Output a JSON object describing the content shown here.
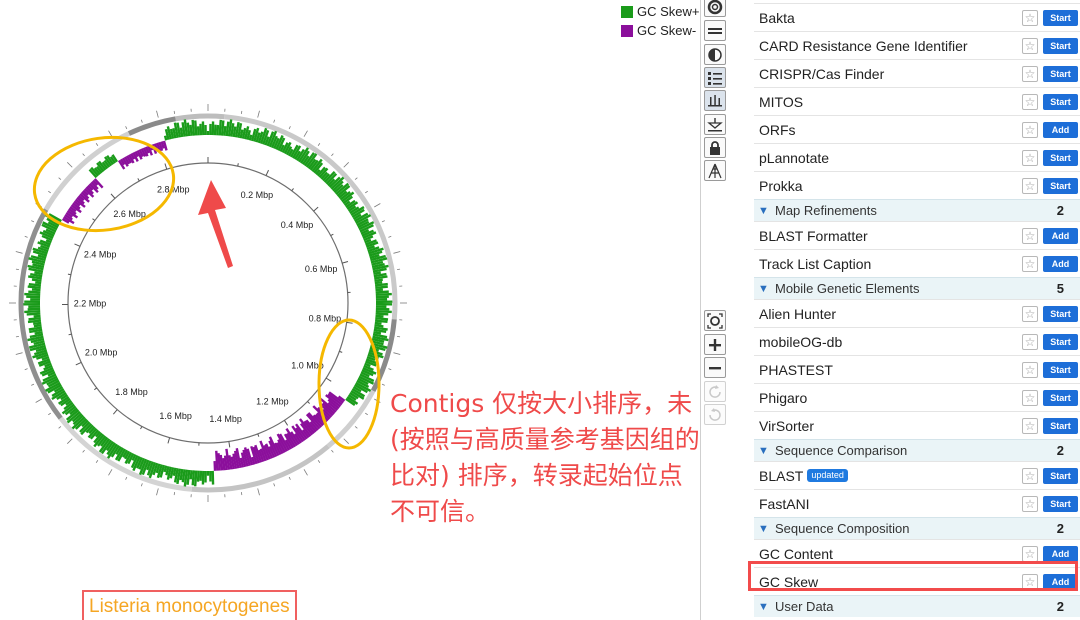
{
  "legend": [
    {
      "label": "GC Skew+",
      "color": "#1a9b1a"
    },
    {
      "label": "GC Skew-",
      "color": "#8b0f9b"
    }
  ],
  "map": {
    "tick_labels": [
      "0.2 Mbp",
      "0.4 Mbp",
      "0.6 Mbp",
      "0.8 Mbp",
      "1.0 Mbp",
      "1.2 Mbp",
      "1.4 Mbp",
      "1.6 Mbp",
      "1.8 Mbp",
      "2.0 Mbp",
      "2.2 Mbp",
      "2.4 Mbp",
      "2.6 Mbp",
      "2.8 Mbp"
    ],
    "skew_positive_color": "#1a9b1a",
    "skew_negative_color": "#8b0f9b",
    "annotation_circle_color": "#f5b800",
    "arrow_color": "#ef4a4a"
  },
  "annotation": {
    "note": "Contigs 仅按大小排序，未 (按照与高质量参考基因组的比对) 排序，转录起始位点不可信。",
    "species": "Listeria monocytogenes"
  },
  "toolbar": {
    "icons": [
      "ring-icon",
      "rows-icon",
      "contrast-icon",
      "legend-list-icon",
      "tracks-icon",
      "anchor-icon",
      "lock-icon",
      "ladder-icon",
      "zoom-fit-icon",
      "zoom-in-icon",
      "zoom-out-icon",
      "rotate-icon",
      "reset-icon"
    ]
  },
  "panel": {
    "items": [
      {
        "type": "tool",
        "label": "Bakta",
        "action": "Start"
      },
      {
        "type": "tool",
        "label": "CARD Resistance Gene Identifier",
        "action": "Start"
      },
      {
        "type": "tool",
        "label": "CRISPR/Cas Finder",
        "action": "Start"
      },
      {
        "type": "tool",
        "label": "MITOS",
        "action": "Start"
      },
      {
        "type": "tool",
        "label": "ORFs",
        "action": "Add"
      },
      {
        "type": "tool",
        "label": "pLannotate",
        "action": "Start"
      },
      {
        "type": "tool",
        "label": "Prokka",
        "action": "Start"
      },
      {
        "type": "section",
        "label": "Map Refinements",
        "count": "2"
      },
      {
        "type": "tool",
        "label": "BLAST Formatter",
        "action": "Add"
      },
      {
        "type": "tool",
        "label": "Track List Caption",
        "action": "Add"
      },
      {
        "type": "section",
        "label": "Mobile Genetic Elements",
        "count": "5"
      },
      {
        "type": "tool",
        "label": "Alien Hunter",
        "action": "Start"
      },
      {
        "type": "tool",
        "label": "mobileOG-db",
        "action": "Start"
      },
      {
        "type": "tool",
        "label": "PHASTEST",
        "action": "Start"
      },
      {
        "type": "tool",
        "label": "Phigaro",
        "action": "Start"
      },
      {
        "type": "tool",
        "label": "VirSorter",
        "action": "Start"
      },
      {
        "type": "section",
        "label": "Sequence Comparison",
        "count": "2"
      },
      {
        "type": "tool",
        "label": "BLAST",
        "badge": "updated",
        "action": "Start"
      },
      {
        "type": "tool",
        "label": "FastANI",
        "action": "Start"
      },
      {
        "type": "section",
        "label": "Sequence Composition",
        "count": "2"
      },
      {
        "type": "tool",
        "label": "GC Content",
        "action": "Add"
      },
      {
        "type": "tool",
        "label": "GC Skew",
        "action": "Add",
        "highlighted": true
      },
      {
        "type": "section",
        "label": "User Data",
        "count": "2"
      }
    ]
  }
}
